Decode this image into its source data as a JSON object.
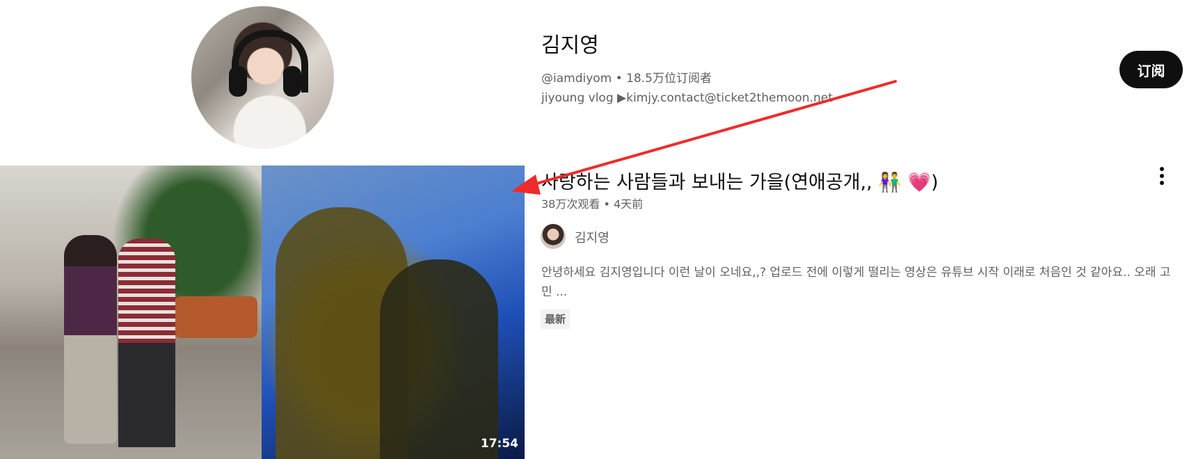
{
  "channel": {
    "name": "김지영",
    "handle": "@iamdiyom",
    "separator": "•",
    "subscribers": "18.5万位订阅者",
    "description": "jiyoung vlog ▶kimjy.contact@ticket2themoon.net"
  },
  "subscribe_label": "订阅",
  "video": {
    "title": "사랑하는 사람들과 보내는 가을(연애공개,, 👫 💗)",
    "views": "38万次观看",
    "separator": "•",
    "age": "4天前",
    "duration": "17:54",
    "author": "김지영",
    "description": "안녕하세요 김지영입니다 이런 날이 오네요,,? 업로드 전에 이렇게 떨리는 영상은 유튜브 시작 이래로 처음인 것 같아요.. 오래 고민 ...",
    "badge": "最新"
  },
  "annotation": {
    "color": "#ef2b2b"
  }
}
